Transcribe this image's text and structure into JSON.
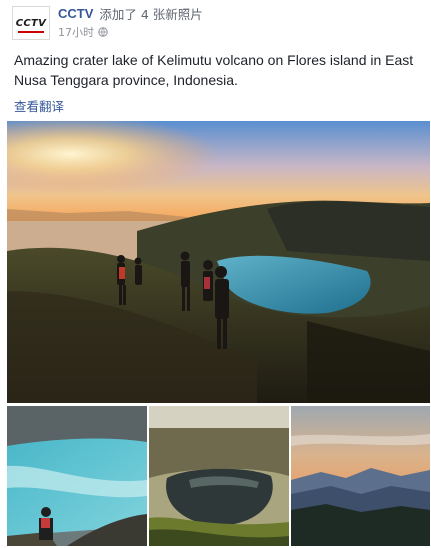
{
  "post": {
    "author": "CCTV",
    "action": "添加了 4 张新照片",
    "time": "17小时",
    "text": "Amazing crater lake of Kelimutu volcano on Flores island in East Nusa Tenggara province, Indonesia.",
    "translate_label": "查看翻译"
  },
  "avatar": {
    "logo_text": "CCTV"
  },
  "icons": {
    "privacy": "globe-icon"
  },
  "colors": {
    "author_link": "#365899",
    "meta": "#90949c",
    "text": "#1d2129"
  },
  "photos": [
    {
      "name": "crater-lake-sunrise-hikers"
    },
    {
      "name": "turquoise-crater-lake-photographer"
    },
    {
      "name": "dark-crater-lake"
    },
    {
      "name": "sunrise-mountain-ridges"
    }
  ]
}
